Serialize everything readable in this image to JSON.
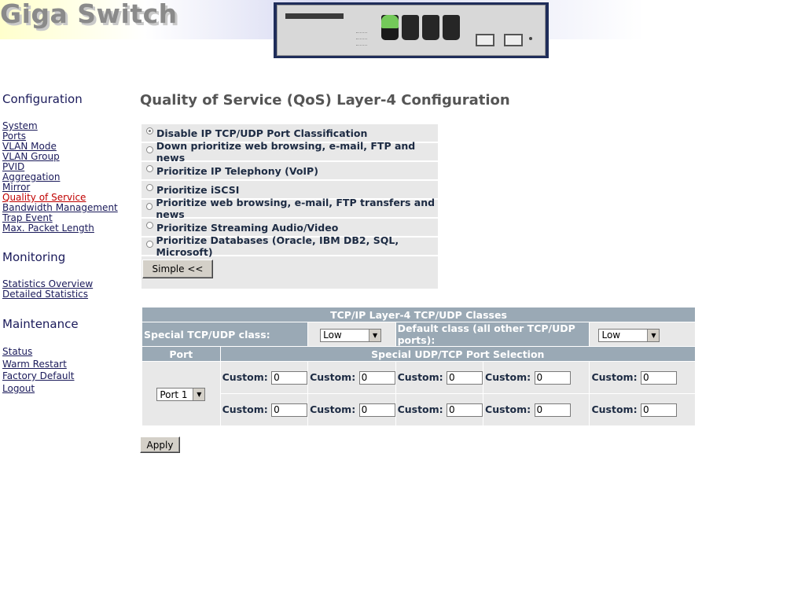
{
  "header": {
    "logo_text": "Giga Switch"
  },
  "sidebar": {
    "configuration_title": "Configuration",
    "configuration_items": [
      {
        "label": "System"
      },
      {
        "label": "Ports"
      },
      {
        "label": "VLAN Mode"
      },
      {
        "label": "VLAN Group"
      },
      {
        "label": "PVID"
      },
      {
        "label": "Aggregation"
      },
      {
        "label": "Mirror"
      },
      {
        "label": "Quality of Service"
      },
      {
        "label": "Bandwidth Management"
      },
      {
        "label": "Trap Event"
      },
      {
        "label": "Max. Packet Length"
      }
    ],
    "monitoring_title": "Monitoring",
    "monitoring_items": [
      {
        "label": "Statistics Overview"
      },
      {
        "label": "Detailed Statistics"
      }
    ],
    "maintenance_title": "Maintenance",
    "maintenance_items": [
      {
        "label": "Status"
      },
      {
        "label": "Warm Restart"
      },
      {
        "label": "Factory Default"
      },
      {
        "label": "Logout"
      }
    ],
    "active_item": "Quality of Service"
  },
  "main": {
    "title": "Quality of Service (QoS) Layer-4 Configuration",
    "options": [
      {
        "label": "Disable IP TCP/UDP Port Classification",
        "selected": true
      },
      {
        "label": "Down prioritize web browsing, e-mail, FTP and news",
        "selected": false
      },
      {
        "label": "Prioritize IP Telephony (VoIP)",
        "selected": false
      },
      {
        "label": "Prioritize iSCSI",
        "selected": false
      },
      {
        "label": "Prioritize web browsing, e-mail, FTP transfers and news",
        "selected": false
      },
      {
        "label": "Prioritize Streaming Audio/Video",
        "selected": false
      },
      {
        "label": "Prioritize Databases (Oracle, IBM DB2, SQL, Microsoft)",
        "selected": false
      }
    ],
    "simple_button": "Simple <<",
    "table": {
      "title": "TCP/IP Layer-4 TCP/UDP Classes",
      "special_class_label": "Special TCP/UDP class:",
      "special_class_value": "Low",
      "default_class_label": "Default class (all other TCP/UDP ports):",
      "default_class_value": "Low",
      "port_header": "Port",
      "selection_header": "Special UDP/TCP Port Selection",
      "port_value": "Port 1",
      "custom_label": "Custom:",
      "custom_values": [
        "0",
        "0",
        "0",
        "0",
        "0",
        "0",
        "0",
        "0",
        "0",
        "0"
      ]
    },
    "apply_button": "Apply"
  },
  "colors": {
    "table_header_bg": "#9aa9b5",
    "cell_bg": "#e8e8e8",
    "link": "#1a1a5a",
    "active_link": "#c00000",
    "title_gray": "#555555"
  }
}
